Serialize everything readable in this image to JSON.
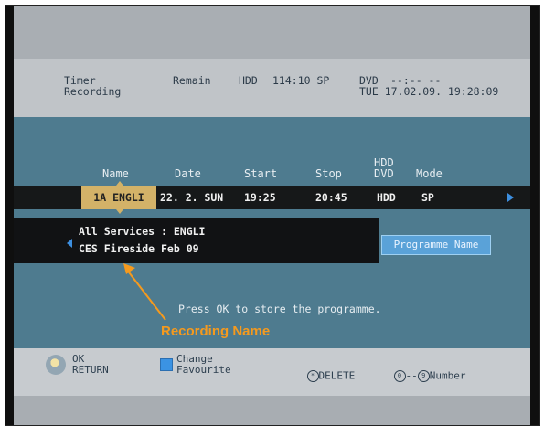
{
  "header": {
    "timer_recording": "Timer\nRecording",
    "remain_label": "Remain",
    "hdd_label": "HDD",
    "hdd_remaining": "114:10 SP",
    "dvd_label": "DVD",
    "dvd_remaining": "--:-- --",
    "datetime": "TUE 17.02.09. 19:28:09"
  },
  "table": {
    "columns": {
      "name": "Name",
      "date": "Date",
      "start": "Start",
      "stop": "Stop",
      "hdd_dvd": "HDD\nDVD",
      "mode": "Mode"
    },
    "row": {
      "name": "1A ENGLI",
      "date": "22. 2. SUN",
      "start": "19:25",
      "stop": "20:45",
      "hdd_dvd": "HDD",
      "mode": "SP"
    }
  },
  "popup": {
    "services": "All Services : ENGLI",
    "recording_name": "CES Fireside Feb 09"
  },
  "programme_name_button": "Programme Name",
  "instruction": "Press OK to store the programme.",
  "annotation": {
    "label": "Recording Name",
    "color": "#f59a1e"
  },
  "footer": {
    "ok_return": "OK\nRETURN",
    "change_favourite": "Change\nFavourite",
    "delete_label": "DELETE",
    "number_label": "Number",
    "zero": "0",
    "nine": "9",
    "dash": "--"
  },
  "colors": {
    "main_band": "#4e7b8f",
    "selected_cell": "#d3b268",
    "accent_blue": "#3b93e3"
  }
}
